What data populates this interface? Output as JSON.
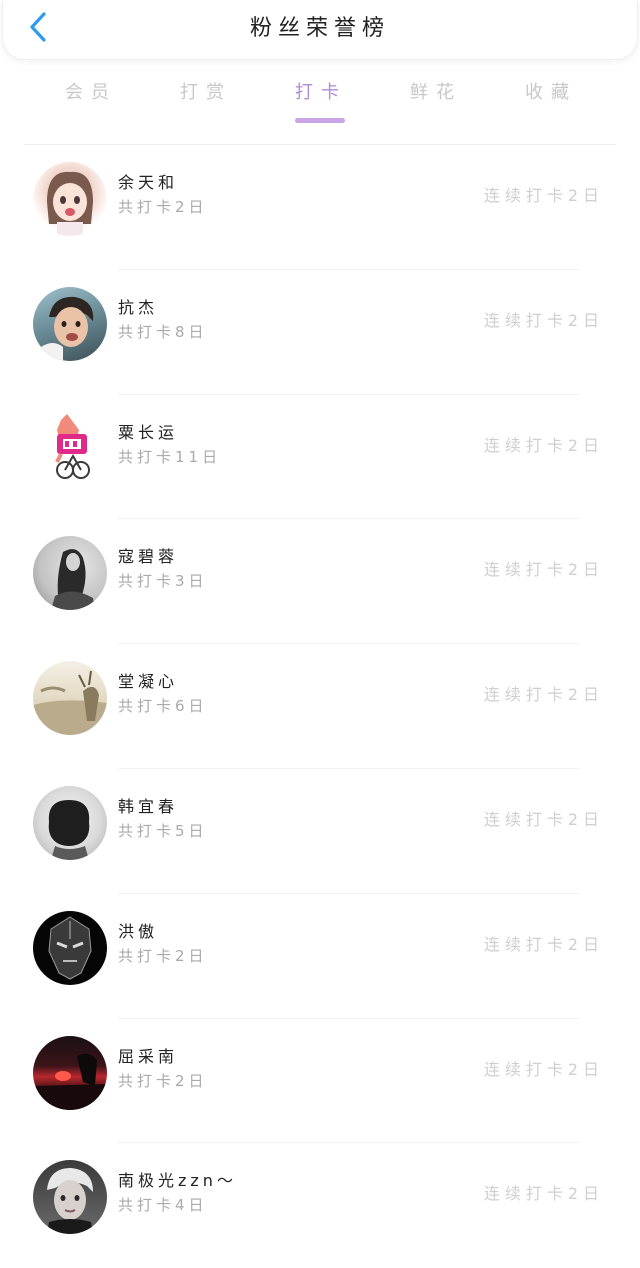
{
  "header": {
    "title": "粉丝荣誉榜"
  },
  "tabs": [
    {
      "label": "会员",
      "active": false
    },
    {
      "label": "打赏",
      "active": false
    },
    {
      "label": "打卡",
      "active": true
    },
    {
      "label": "鲜花",
      "active": false
    },
    {
      "label": "收藏",
      "active": false
    }
  ],
  "colors": {
    "accent": "#b08bd6",
    "back_icon": "#2f9bf0"
  },
  "fans": [
    {
      "name": "余天和",
      "total": "共打卡2日",
      "streak": "连续打卡2日",
      "avatar": "avatar-cartoon-girl"
    },
    {
      "name": "抗杰",
      "total": "共打卡8日",
      "streak": "连续打卡2日",
      "avatar": "avatar-boy-photo"
    },
    {
      "name": "粟长运",
      "total": "共打卡11日",
      "streak": "连续打卡2日",
      "avatar": "avatar-patrick-bike"
    },
    {
      "name": "寇碧蓉",
      "total": "共打卡3日",
      "streak": "连续打卡2日",
      "avatar": "avatar-girl-grayscale"
    },
    {
      "name": "堂凝心",
      "total": "共打卡6日",
      "streak": "连续打卡2日",
      "avatar": "avatar-deer-field"
    },
    {
      "name": "韩宜春",
      "total": "共打卡5日",
      "streak": "连续打卡2日",
      "avatar": "avatar-curly-hair"
    },
    {
      "name": "洪傲",
      "total": "共打卡2日",
      "streak": "连续打卡2日",
      "avatar": "avatar-dark-mask"
    },
    {
      "name": "屈采南",
      "total": "共打卡2日",
      "streak": "连续打卡2日",
      "avatar": "avatar-sunset"
    },
    {
      "name": "南极光zzn～",
      "total": "共打卡4日",
      "streak": "连续打卡2日",
      "avatar": "avatar-blond-boy"
    }
  ]
}
